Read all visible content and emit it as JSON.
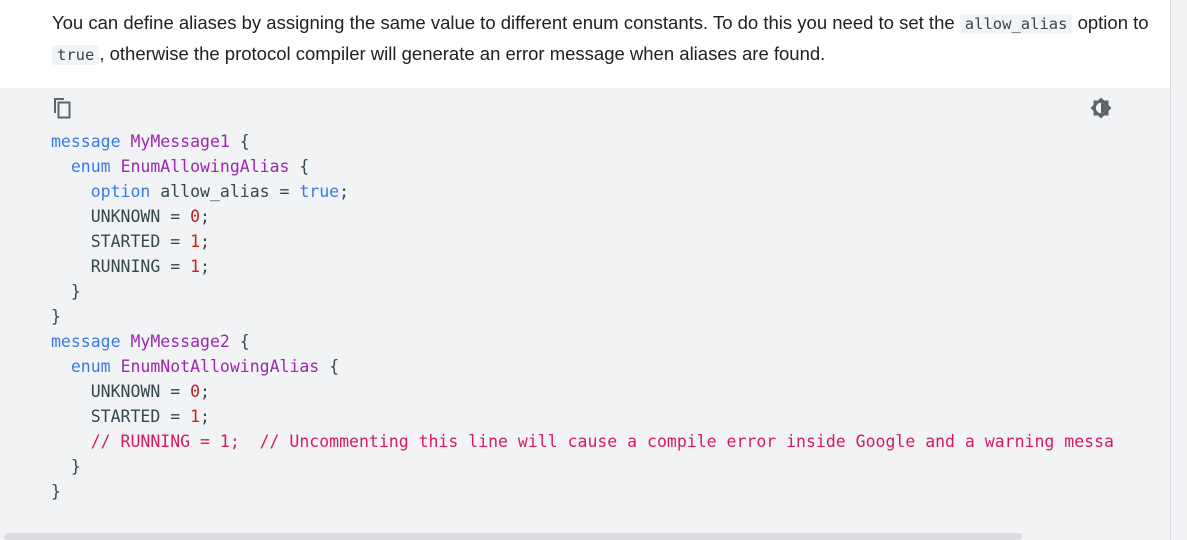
{
  "paragraph": {
    "text_before": "You can define aliases by assigning the same value to different enum constants. To do this you need to set the",
    "code1": "allow_alias",
    "text_mid": "option to",
    "code2": "true",
    "text_after": ", otherwise the protocol compiler will generate an error message when aliases are found."
  },
  "toolbar": {
    "copy_icon": "copy-icon",
    "theme_icon": "brightness-icon"
  },
  "code": {
    "l1": {
      "kw": "message",
      "name": "MyMessage1",
      "brace": "{"
    },
    "l2": {
      "kw": "enum",
      "name": "EnumAllowingAlias",
      "brace": "{"
    },
    "l3": {
      "kw": "option",
      "text": "allow_alias =",
      "val": "true",
      "semi": ";"
    },
    "l4": {
      "name": "UNKNOWN =",
      "num": "0",
      "semi": ";"
    },
    "l5": {
      "name": "STARTED =",
      "num": "1",
      "semi": ";"
    },
    "l6": {
      "name": "RUNNING =",
      "num": "1",
      "semi": ";"
    },
    "l7": "}",
    "l8": "}",
    "l9": {
      "kw": "message",
      "name": "MyMessage2",
      "brace": "{"
    },
    "l10": {
      "kw": "enum",
      "name": "EnumNotAllowingAlias",
      "brace": "{"
    },
    "l11": {
      "name": "UNKNOWN =",
      "num": "0",
      "semi": ";"
    },
    "l12": {
      "name": "STARTED =",
      "num": "1",
      "semi": ";"
    },
    "l13": "// RUNNING = 1;  // Uncommenting this line will cause a compile error inside Google and a warning messa",
    "l14": "}",
    "l15": "}"
  },
  "colors": {
    "keyword": "#3b78e7",
    "type": "#9c27b0",
    "number": "#c5221f",
    "comment": "#d81b60",
    "code_bg": "#f1f3f4"
  }
}
